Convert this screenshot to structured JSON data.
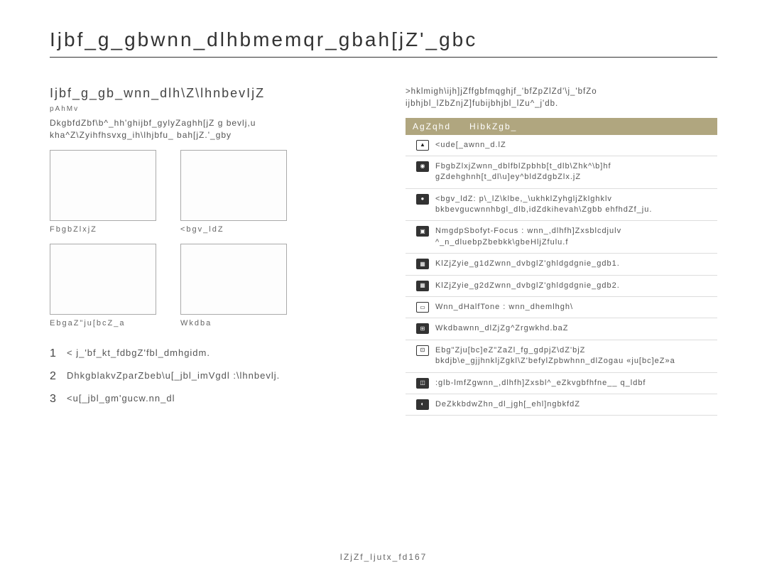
{
  "title": "Ijbf_g_gbwnn_dlhbmemqr_gbah[jZ'_gbc",
  "left": {
    "subtitle": "Ijbf_g_gb_wnn_dlh\\Z\\lhnbevIjZ",
    "shot": "pAhMv",
    "desc": "DkgbfdZbf\\b^_hh'ghijbf_gylyZaghh[jZ g bevlj,u kha^Z\\Zyihfhsvxg_ih\\lhjbfu_ bah[jZ.'_gby",
    "thumbs": [
      {
        "label": "FbgbZlxjZ"
      },
      {
        "label": "<bgv_ldZ"
      },
      {
        "label": "EbgaZ\"ju[bcZ_a"
      },
      {
        "label": "Wkdba"
      }
    ],
    "steps": [
      "< j_'bf_kt_fdbgZ'fbl_dmhgidm.",
      "DhkgblakvZparZbeb\\u[_jbl_imVgdl :\\lhnbevlj.",
      "<u[_jbl_gm'gucw.nn_dl"
    ]
  },
  "right": {
    "desc": ">hklmigh\\ijh]jZffgbfmqghjf_'bfZpZlZd'\\j_'bfZo ijbhjbl_lZbZnjZ]fubijbhjbl_lZu^_j'db.",
    "table": {
      "header": {
        "icon": "AgZqhd",
        "desc": "HibkZgb_"
      },
      "rows": [
        {
          "icon": "▲",
          "iconClass": "",
          "desc": "<ude[_awnn_d.lZ"
        },
        {
          "icon": "◉",
          "iconClass": "dark",
          "desc": "FbgbZlxjZwnn_dblfblZpbhb[t_dlb\\Zhk^\\b]hf gZdehghnh[t_dl\\u]ey^bldZdgbZlx.jZ"
        },
        {
          "icon": "●",
          "iconClass": "dark",
          "desc": "<bgv_ldZ: p\\_lZ\\klbe,_\\ukhklZyhgljZklghklv bkbevgucwnnhbgl_dlb,idZdkihevah\\Zgbb ehfhdZf_ju."
        },
        {
          "icon": "▣",
          "iconClass": "dark",
          "desc": "NmgdpSbofyt-Focus : wnn_,dlhfh]Zxsblcdjulv ^_n_dluebpZbebkk\\gbeHljZfulu.f"
        },
        {
          "icon": "▦",
          "iconClass": "dark",
          "desc": "KlZjZyie_g1dZwnn_dvbglZ'ghldgdgnie_gdb1."
        },
        {
          "icon": "▦",
          "iconClass": "dark",
          "desc": "KlZjZyie_g2dZwnn_dvbglZ'ghldgdgnie_gdb2."
        },
        {
          "icon": "▭",
          "iconClass": "",
          "desc": "Wnn_dHalfTone : wnn_dhemlhgh\\"
        },
        {
          "icon": "⊞",
          "iconClass": "dark",
          "desc": "Wkdbawnn_dlZjZg^Zrgwkhd.baZ"
        },
        {
          "icon": "⊡",
          "iconClass": "",
          "desc": "Ebg\"Zju[bc]eZ\"ZaZl_fg_gdpjZ\\dZ'bjZ bkdjb\\e_gjjhnkljZgkl\\Z'befylZpbwhnn_dlZogau «ju[bc]eZ»a"
        },
        {
          "icon": "◫",
          "iconClass": "dark",
          "desc": ":glb-lmfZgwnn_,dlhfh]Zxsbl^_eZkvgbfhfne__ q_ldbf"
        },
        {
          "icon": "◐",
          "iconClass": "dark",
          "desc": "DeZkkbdwZhn_dl_jgh[_ehl]ngbkfdZ"
        }
      ]
    }
  },
  "footer": "IZjZf_ljutx_fd167"
}
